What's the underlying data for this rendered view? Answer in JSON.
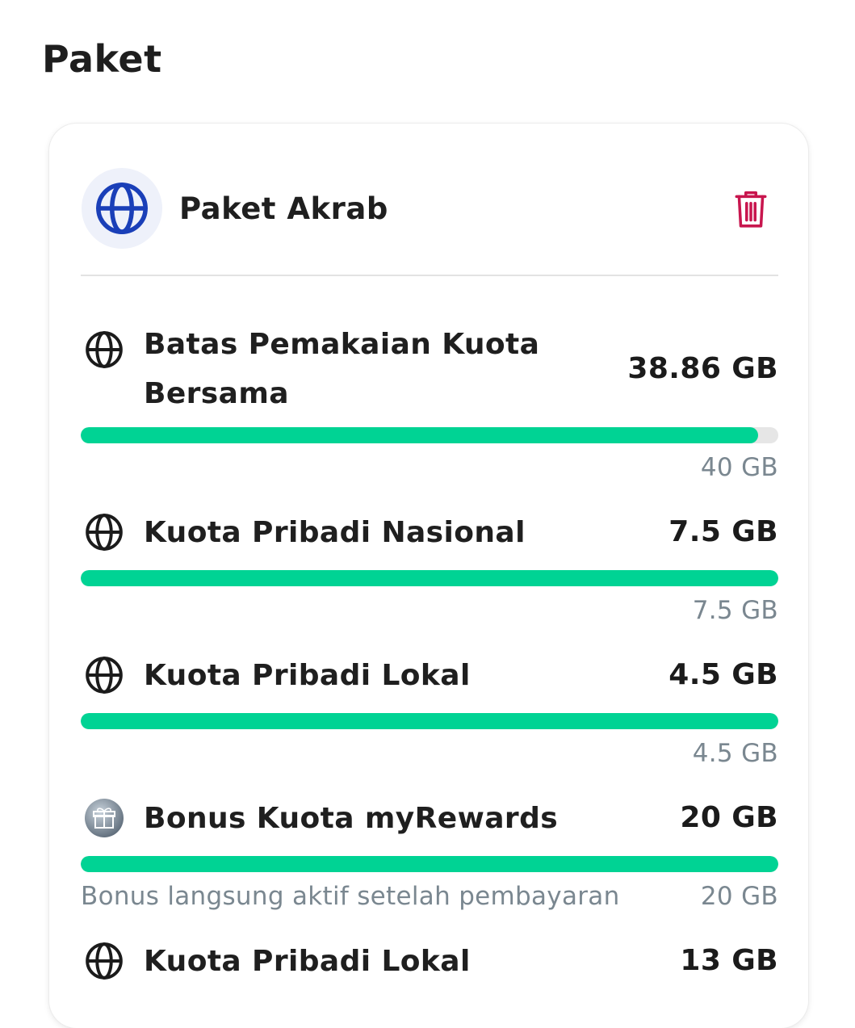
{
  "header": {
    "title": "Paket"
  },
  "package": {
    "name": "Paket Akrab",
    "icon": "globe-icon",
    "action_icon": "trash-icon",
    "colors": {
      "accent": "#1a3fb8",
      "delete": "#c8164e",
      "bar": "#00d394"
    }
  },
  "quotas": [
    {
      "title": "Batas Pemakaian Kuota Bersama",
      "value": "38.86 GB",
      "total": "40 GB",
      "progress": 0.9715,
      "icon": "globe-icon",
      "note": ""
    },
    {
      "title": "Kuota Pribadi Nasional",
      "value": "7.5 GB",
      "total": "7.5 GB",
      "progress": 1.0,
      "icon": "globe-icon",
      "note": ""
    },
    {
      "title": "Kuota Pribadi Lokal",
      "value": "4.5 GB",
      "total": "4.5 GB",
      "progress": 1.0,
      "icon": "globe-icon",
      "note": ""
    },
    {
      "title": "Bonus Kuota myRewards",
      "value": "20 GB",
      "total": "20 GB",
      "progress": 1.0,
      "icon": "gift-icon",
      "note": "Bonus langsung aktif setelah pembayaran"
    },
    {
      "title": "Kuota Pribadi Lokal",
      "value": "13 GB",
      "icon": "globe-icon"
    }
  ]
}
